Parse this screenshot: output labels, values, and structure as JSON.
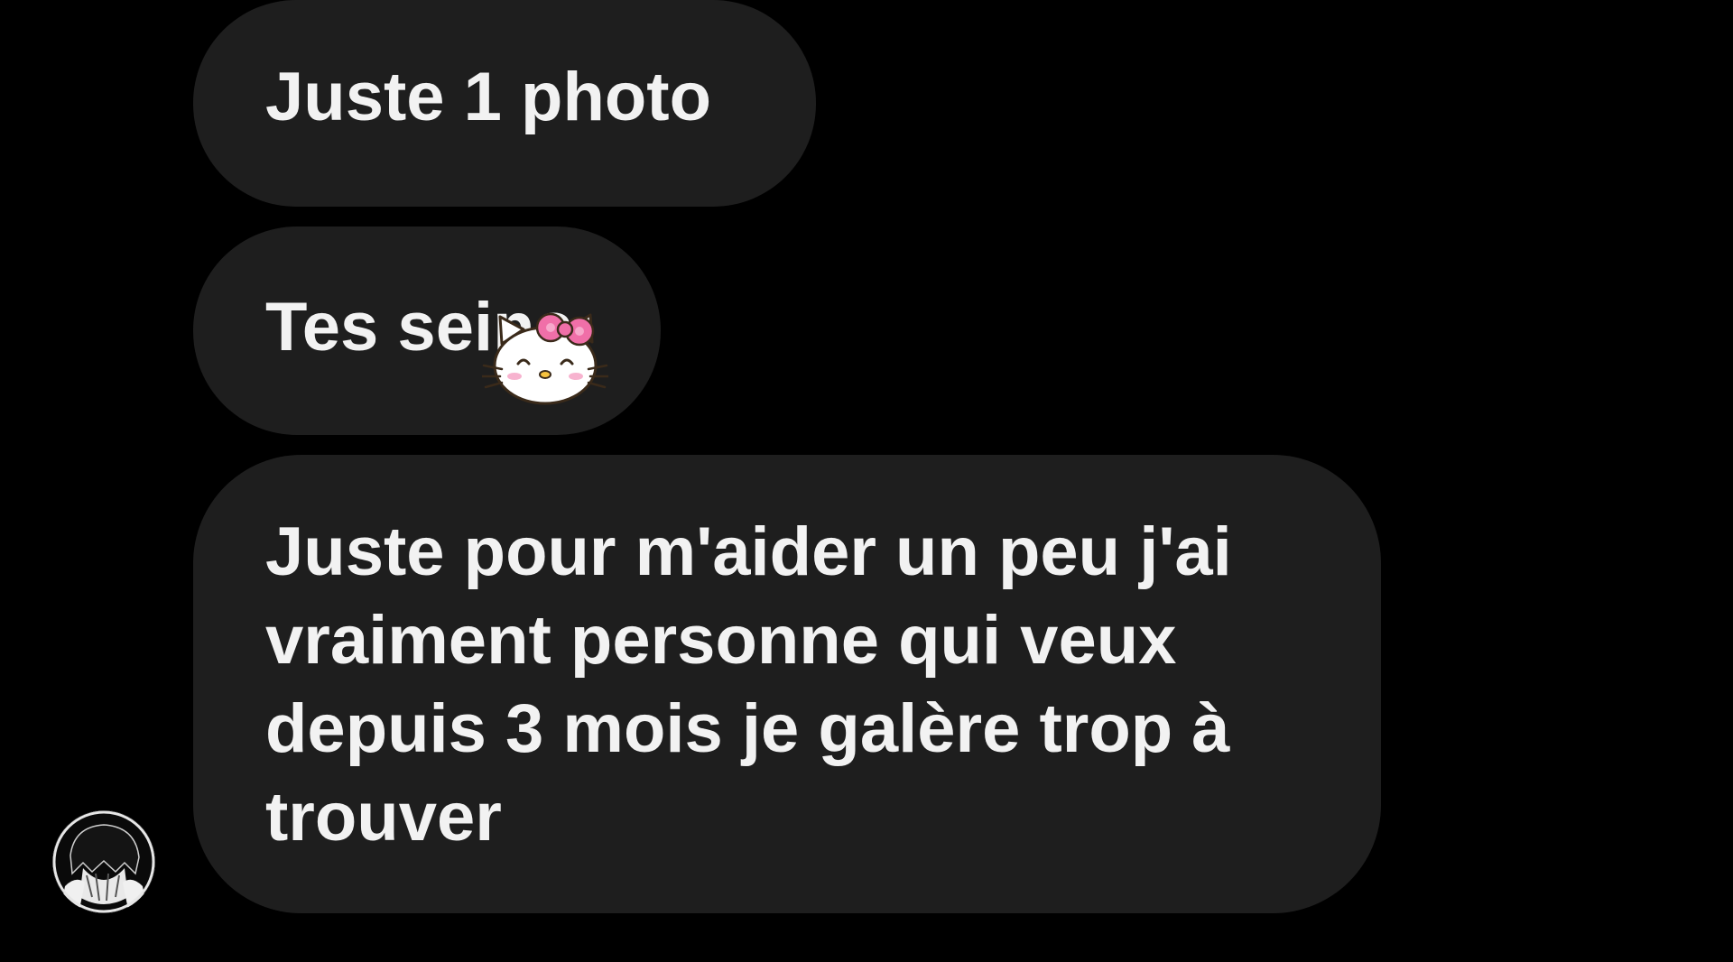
{
  "messages": [
    {
      "text": "Juste 1 photo"
    },
    {
      "text": "Tes seins",
      "sticker": "hello-kitty-sticker"
    },
    {
      "text": "Juste pour m'aider un peu j'ai\nvraiment personne qui veux\ndepuis 3 mois je galère trop à\ntrouver"
    }
  ],
  "sender_avatar": {
    "icon": "profile-avatar-icon"
  },
  "colors": {
    "background": "#000000",
    "bubble": "#1e1e1e",
    "text": "#f2f2f2",
    "sticker_bow": "#f06fa8"
  }
}
